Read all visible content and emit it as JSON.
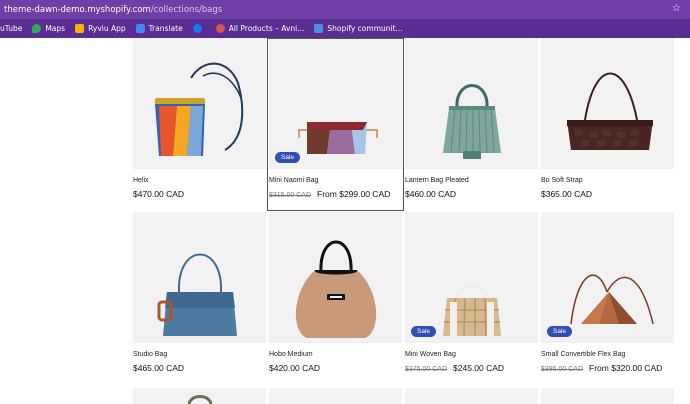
{
  "browser": {
    "url_host": "theme-dawn-demo.myshopify.com",
    "url_path": "/collections/bags",
    "bookmarks": [
      {
        "label": "uTube",
        "icon": "youtube-icon",
        "color": "#ff0000"
      },
      {
        "label": "Maps",
        "icon": "maps-icon",
        "color": "#34a853"
      },
      {
        "label": "Ryviu App",
        "icon": "ryviu-icon",
        "color": "#f5b400"
      },
      {
        "label": "Translate",
        "icon": "translate-icon",
        "color": "#4285f4"
      },
      {
        "label": "",
        "icon": "facebook-icon",
        "color": "#1877f2"
      },
      {
        "label": "All Products – Avni...",
        "icon": "avni-icon",
        "color": "#d9534f"
      },
      {
        "label": "Shopify communit...",
        "icon": "shopify-community-icon",
        "color": "#4a90e2"
      }
    ]
  },
  "products": [
    {
      "title": "Helix",
      "price": "$470.00 CAD",
      "compare": "",
      "sale": ""
    },
    {
      "title": "Mini Naomi Bag",
      "price": "From $299.00 CAD",
      "compare": "$315.00 CAD",
      "sale": "Sale"
    },
    {
      "title": "Lantern Bag Pleated",
      "price": "$460.00 CAD",
      "compare": "",
      "sale": ""
    },
    {
      "title": "Bo Soft Strap",
      "price": "$365.00 CAD",
      "compare": "",
      "sale": ""
    },
    {
      "title": "Studio Bag",
      "price": "$465.00 CAD",
      "compare": "",
      "sale": ""
    },
    {
      "title": "Hobo Medium",
      "price": "$420.00 CAD",
      "compare": "",
      "sale": ""
    },
    {
      "title": "Mini Woven Bag",
      "price": "$245.00 CAD",
      "compare": "$375.00 CAD",
      "sale": "Sale"
    },
    {
      "title": "Small Convertible Flex Bag",
      "price": "From $320.00 CAD",
      "compare": "$395.00 CAD",
      "sale": "Sale"
    }
  ],
  "colors": {
    "chrome": "#6e3fa6",
    "bookmarks": "#5a2d93",
    "sale_badge": "#334fb4"
  }
}
